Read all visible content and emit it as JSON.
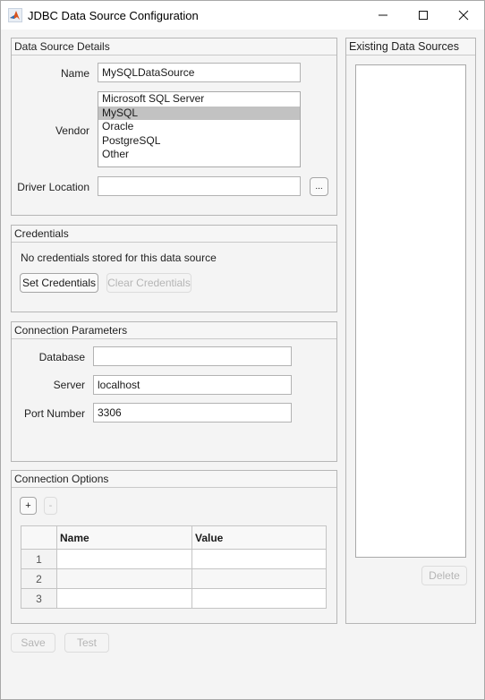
{
  "window": {
    "title": "JDBC Data Source Configuration",
    "app_icon": "matlab-icon",
    "controls": [
      "minimize-icon",
      "maximize-icon",
      "close-icon"
    ]
  },
  "data_source_details": {
    "title": "Data Source Details",
    "name_label": "Name",
    "name_value": "MySQLDataSource",
    "vendor_label": "Vendor",
    "vendor_options": [
      "Microsoft SQL Server",
      "MySQL",
      "Oracle",
      "PostgreSQL",
      "Other"
    ],
    "vendor_selected": "MySQL",
    "driver_label": "Driver Location",
    "driver_value": "",
    "browse_label": "..."
  },
  "credentials": {
    "title": "Credentials",
    "status_text": "No credentials stored for this data source",
    "set_label": "Set Credentials",
    "clear_label": "Clear Credentials"
  },
  "connection_parameters": {
    "title": "Connection Parameters",
    "database_label": "Database",
    "database_value": "",
    "server_label": "Server",
    "server_value": "localhost",
    "port_label": "Port Number",
    "port_value": "3306"
  },
  "connection_options": {
    "title": "Connection Options",
    "add_label": "+",
    "remove_label": "-",
    "columns": [
      "Name",
      "Value"
    ],
    "rows": [
      {
        "index": "1",
        "name": "",
        "value": ""
      },
      {
        "index": "2",
        "name": "",
        "value": ""
      },
      {
        "index": "3",
        "name": "",
        "value": ""
      }
    ]
  },
  "existing": {
    "title": "Existing Data Sources",
    "items": [],
    "delete_label": "Delete"
  },
  "footer": {
    "save_label": "Save",
    "test_label": "Test"
  }
}
